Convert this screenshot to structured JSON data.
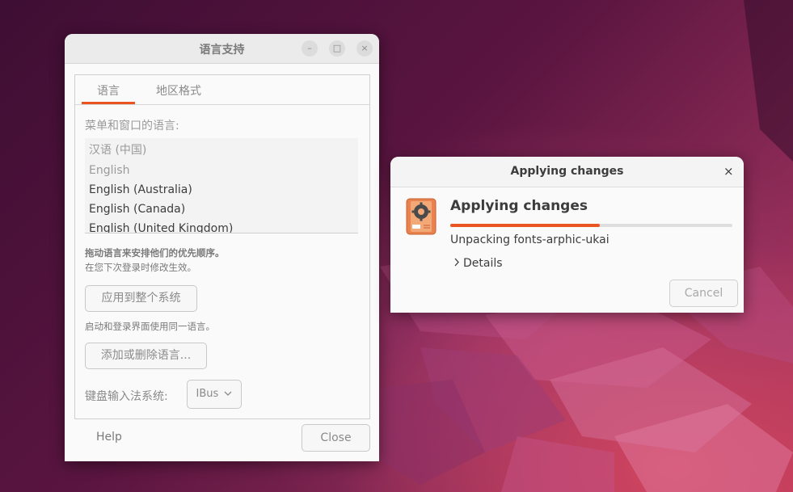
{
  "language_support": {
    "window_title": "语言支持",
    "controls": {
      "minimize": "–",
      "maximize": "□",
      "close": "×"
    },
    "tabs": [
      {
        "label": "语言",
        "active": true
      },
      {
        "label": "地区格式",
        "active": false
      }
    ],
    "section_label": "菜单和窗口的语言:",
    "languages": [
      {
        "label": "汉语 (中国)"
      },
      {
        "label": "English"
      },
      {
        "label": "English (Australia)"
      },
      {
        "label": "English (Canada)"
      },
      {
        "label": "English (United Kingdom)"
      }
    ],
    "hint_drag": "拖动语言来安排他们的优先顺序。",
    "hint_next_login": "在您下次登录时修改生效。",
    "apply_system_button": "应用到整个系统",
    "hint_login_screen": "启动和登录界面使用同一语言。",
    "add_remove_button": "添加或删除语言...",
    "keyboard_label": "键盘输入法系统:",
    "keyboard_value": "IBus",
    "help_button": "Help",
    "close_button": "Close"
  },
  "apply_dialog": {
    "window_title": "Applying changes",
    "heading": "Applying changes",
    "progress_fraction": 0.53,
    "status": "Unpacking fonts-arphic-ukai",
    "details_label": "Details",
    "cancel_button": "Cancel",
    "close_icon": "×"
  },
  "colors": {
    "accent": "#e95420"
  }
}
